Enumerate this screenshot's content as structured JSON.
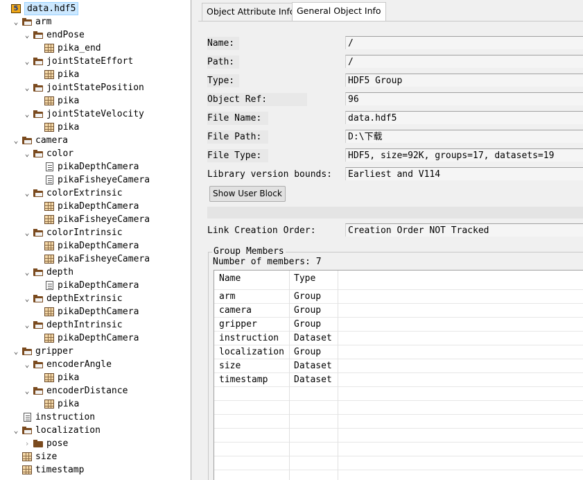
{
  "tree": [
    {
      "label": "data.hdf5",
      "icon": "hdf5-file-icon",
      "level": 0,
      "chevron": "",
      "selected": true,
      "name": "tree-root-data-hdf5"
    },
    {
      "label": "arm",
      "icon": "folder-open-icon",
      "level": 1,
      "chevron": "expanded",
      "name": "tree-group-arm"
    },
    {
      "label": "endPose",
      "icon": "folder-open-icon",
      "level": 2,
      "chevron": "expanded",
      "name": "tree-group-endpose"
    },
    {
      "label": "pika_end",
      "icon": "dataset-icon",
      "level": 3,
      "chevron": "",
      "name": "tree-dataset-pika-end"
    },
    {
      "label": "jointStateEffort",
      "icon": "folder-open-icon",
      "level": 2,
      "chevron": "expanded",
      "name": "tree-group-jointstateeffort"
    },
    {
      "label": "pika",
      "icon": "dataset-icon",
      "level": 3,
      "chevron": "",
      "name": "tree-dataset-pika"
    },
    {
      "label": "jointStatePosition",
      "icon": "folder-open-icon",
      "level": 2,
      "chevron": "expanded",
      "name": "tree-group-jointstateposition"
    },
    {
      "label": "pika",
      "icon": "dataset-icon",
      "level": 3,
      "chevron": "",
      "name": "tree-dataset-pika"
    },
    {
      "label": "jointStateVelocity",
      "icon": "folder-open-icon",
      "level": 2,
      "chevron": "expanded",
      "name": "tree-group-jointstatevelocity"
    },
    {
      "label": "pika",
      "icon": "dataset-icon",
      "level": 3,
      "chevron": "",
      "name": "tree-dataset-pika"
    },
    {
      "label": "camera",
      "icon": "folder-open-icon",
      "level": 1,
      "chevron": "expanded",
      "name": "tree-group-camera"
    },
    {
      "label": "color",
      "icon": "folder-open-icon",
      "level": 2,
      "chevron": "expanded",
      "name": "tree-group-color"
    },
    {
      "label": "pikaDepthCamera",
      "icon": "text-dataset-icon",
      "level": 3,
      "chevron": "",
      "name": "tree-dataset-pikadepthcamera"
    },
    {
      "label": "pikaFisheyeCamera",
      "icon": "text-dataset-icon",
      "level": 3,
      "chevron": "",
      "name": "tree-dataset-pikafisheyecamera"
    },
    {
      "label": "colorExtrinsic",
      "icon": "folder-open-icon",
      "level": 2,
      "chevron": "expanded",
      "name": "tree-group-colorextrinsic"
    },
    {
      "label": "pikaDepthCamera",
      "icon": "dataset-icon",
      "level": 3,
      "chevron": "",
      "name": "tree-dataset-pikadepthcamera"
    },
    {
      "label": "pikaFisheyeCamera",
      "icon": "dataset-icon",
      "level": 3,
      "chevron": "",
      "name": "tree-dataset-pikafisheyecamera"
    },
    {
      "label": "colorIntrinsic",
      "icon": "folder-open-icon",
      "level": 2,
      "chevron": "expanded",
      "name": "tree-group-colorintrinsic"
    },
    {
      "label": "pikaDepthCamera",
      "icon": "dataset-icon",
      "level": 3,
      "chevron": "",
      "name": "tree-dataset-pikadepthcamera"
    },
    {
      "label": "pikaFisheyeCamera",
      "icon": "dataset-icon",
      "level": 3,
      "chevron": "",
      "name": "tree-dataset-pikafisheyecamera"
    },
    {
      "label": "depth",
      "icon": "folder-open-icon",
      "level": 2,
      "chevron": "expanded",
      "name": "tree-group-depth"
    },
    {
      "label": "pikaDepthCamera",
      "icon": "text-dataset-icon",
      "level": 3,
      "chevron": "",
      "name": "tree-dataset-pikadepthcamera"
    },
    {
      "label": "depthExtrinsic",
      "icon": "folder-open-icon",
      "level": 2,
      "chevron": "expanded",
      "name": "tree-group-depthextrinsic"
    },
    {
      "label": "pikaDepthCamera",
      "icon": "dataset-icon",
      "level": 3,
      "chevron": "",
      "name": "tree-dataset-pikadepthcamera"
    },
    {
      "label": "depthIntrinsic",
      "icon": "folder-open-icon",
      "level": 2,
      "chevron": "expanded",
      "name": "tree-group-depthintrinsic"
    },
    {
      "label": "pikaDepthCamera",
      "icon": "dataset-icon",
      "level": 3,
      "chevron": "",
      "name": "tree-dataset-pikadepthcamera"
    },
    {
      "label": "gripper",
      "icon": "folder-open-icon",
      "level": 1,
      "chevron": "expanded",
      "name": "tree-group-gripper"
    },
    {
      "label": "encoderAngle",
      "icon": "folder-open-icon",
      "level": 2,
      "chevron": "expanded",
      "name": "tree-group-encoderangle"
    },
    {
      "label": "pika",
      "icon": "dataset-icon",
      "level": 3,
      "chevron": "",
      "name": "tree-dataset-pika"
    },
    {
      "label": "encoderDistance",
      "icon": "folder-open-icon",
      "level": 2,
      "chevron": "expanded",
      "name": "tree-group-encoderdistance"
    },
    {
      "label": "pika",
      "icon": "dataset-icon",
      "level": 3,
      "chevron": "",
      "name": "tree-dataset-pika"
    },
    {
      "label": "instruction",
      "icon": "text-dataset-icon",
      "level": 1,
      "chevron": "",
      "name": "tree-dataset-instruction"
    },
    {
      "label": "localization",
      "icon": "folder-open-icon",
      "level": 1,
      "chevron": "expanded",
      "name": "tree-group-localization"
    },
    {
      "label": "pose",
      "icon": "folder-closed-icon",
      "level": 2,
      "chevron": "collapsed",
      "name": "tree-group-pose"
    },
    {
      "label": "size",
      "icon": "dataset-icon",
      "level": 1,
      "chevron": "",
      "name": "tree-dataset-size"
    },
    {
      "label": "timestamp",
      "icon": "dataset-icon",
      "level": 1,
      "chevron": "",
      "name": "tree-dataset-timestamp"
    }
  ],
  "tabs": [
    {
      "label": "Object Attribute Info",
      "active": false
    },
    {
      "label": "General Object Info",
      "active": true
    }
  ],
  "info": {
    "name_label": "Name:",
    "name_value": "/",
    "path_label": "Path:",
    "path_value": "/",
    "type_label": "Type:",
    "type_value": "HDF5 Group",
    "objref_label": "Object Ref:",
    "objref_value": "96",
    "filename_label": "File Name:",
    "filename_value": "data.hdf5",
    "filepath_label": "File Path:",
    "filepath_value": "D:\\下载",
    "filetype_label": "File Type:",
    "filetype_value": "HDF5,  size=92K,  groups=17,  datasets=19",
    "libver_label": "Library version bounds:",
    "libver_value": "Earliest and V114",
    "show_user_block_label": "Show User Block",
    "link_order_label": "Link Creation Order:",
    "link_order_value": "Creation Order NOT Tracked"
  },
  "members": {
    "title": "Group Members",
    "count_text": "Number of members: 7",
    "headers": [
      "Name",
      "Type"
    ],
    "rows": [
      [
        "arm",
        "Group"
      ],
      [
        "camera",
        "Group"
      ],
      [
        "gripper",
        "Group"
      ],
      [
        "instruction",
        "Dataset"
      ],
      [
        "localization",
        "Group"
      ],
      [
        "size",
        "Dataset"
      ],
      [
        "timestamp",
        "Dataset"
      ]
    ],
    "empty_rows": 7
  }
}
